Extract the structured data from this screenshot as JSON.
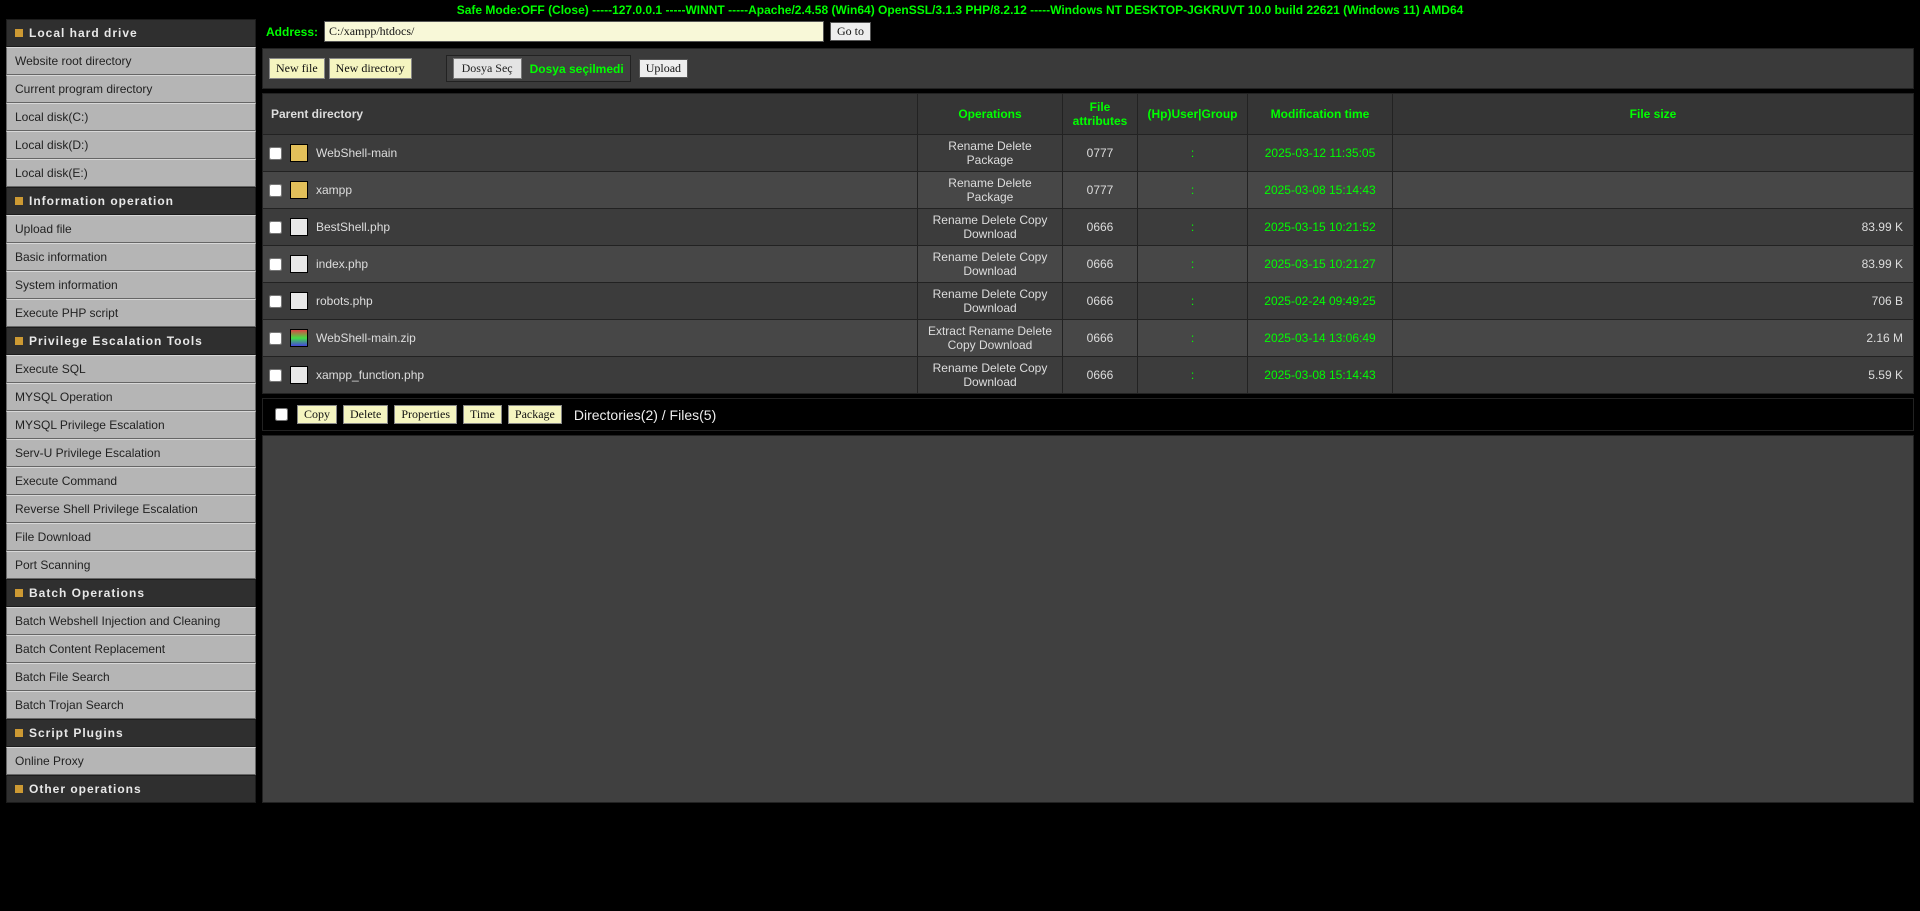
{
  "topbar": {
    "safe_mode_label": "Safe Mode:OFF",
    "close": "(Close)",
    "sep": "-----",
    "ip": "127.0.0.1",
    "os_short": "WINNT",
    "server": "Apache/2.4.58 (Win64) OpenSSL/3.1.3 PHP/8.2.12",
    "os_long": "Windows NT DESKTOP-JGKRUVT 10.0 build 22621 (Windows 11) AMD64"
  },
  "address": {
    "label": "Address:",
    "value": "C:/xampp/htdocs/",
    "go": "Go to"
  },
  "toolbar": {
    "new_file": "New file",
    "new_dir": "New directory",
    "choose": "Dosya Seç",
    "nochoice": "Dosya seçilmedi",
    "upload": "Upload"
  },
  "sidebar": {
    "sections": [
      {
        "title": "Local hard drive",
        "items": [
          "Website root directory",
          "Current program directory",
          "Local disk(C:)",
          "Local disk(D:)",
          "Local disk(E:)"
        ]
      },
      {
        "title": "Information operation",
        "items": [
          "Upload file",
          "Basic information",
          "System information",
          "Execute PHP script"
        ]
      },
      {
        "title": "Privilege Escalation Tools",
        "items": [
          "Execute SQL",
          "MYSQL Operation",
          "MYSQL Privilege Escalation",
          "Serv-U Privilege Escalation",
          "Execute Command",
          "Reverse Shell Privilege Escalation",
          "File Download",
          "Port Scanning"
        ]
      },
      {
        "title": "Batch Operations",
        "items": [
          "Batch Webshell Injection and Cleaning",
          "Batch Content Replacement",
          "Batch File Search",
          "Batch Trojan Search"
        ]
      },
      {
        "title": "Script Plugins",
        "items": [
          "Online Proxy"
        ]
      },
      {
        "title": "Other operations",
        "items": []
      }
    ]
  },
  "columns": {
    "parent": "Parent directory",
    "ops": "Operations",
    "attr": "File attributes",
    "ug": "(Hp)User|Group",
    "mtime": "Modification time",
    "size": "File size"
  },
  "rows": [
    {
      "type": "dir",
      "name": "WebShell-main",
      "ops": "Rename Delete Package",
      "attr": "0777",
      "ug": ":",
      "mtime": "2025-03-12 11:35:05",
      "size": ""
    },
    {
      "type": "dir",
      "name": "xampp",
      "ops": "Rename Delete Package",
      "attr": "0777",
      "ug": ":",
      "mtime": "2025-03-08 15:14:43",
      "size": ""
    },
    {
      "type": "file",
      "name": "BestShell.php",
      "ops": "Rename Delete Copy Download",
      "attr": "0666",
      "ug": ":",
      "mtime": "2025-03-15 10:21:52",
      "size": "83.99 K"
    },
    {
      "type": "file",
      "name": "index.php",
      "ops": "Rename Delete Copy Download",
      "attr": "0666",
      "ug": ":",
      "mtime": "2025-03-15 10:21:27",
      "size": "83.99 K"
    },
    {
      "type": "file",
      "name": "robots.php",
      "ops": "Rename Delete Copy Download",
      "attr": "0666",
      "ug": ":",
      "mtime": "2025-02-24 09:49:25",
      "size": "706 B"
    },
    {
      "type": "zip",
      "name": "WebShell-main.zip",
      "ops": "Extract Rename Delete Copy Download",
      "attr": "0666",
      "ug": ":",
      "mtime": "2025-03-14 13:06:49",
      "size": "2.16 M"
    },
    {
      "type": "file",
      "name": "xampp_function.php",
      "ops": "Rename Delete Copy Download",
      "attr": "0666",
      "ug": ":",
      "mtime": "2025-03-08 15:14:43",
      "size": "5.59 K"
    }
  ],
  "footer": {
    "copy": "Copy",
    "delete": "Delete",
    "props": "Properties",
    "time": "Time",
    "package": "Package",
    "summary": "Directories(2) / Files(5)"
  }
}
